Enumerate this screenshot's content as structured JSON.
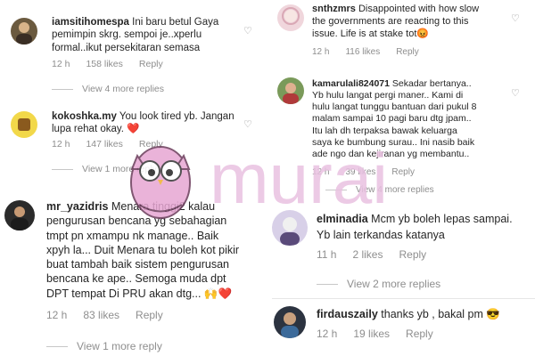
{
  "comments": [
    {
      "username": "iamsitihomespa",
      "text_lines": [
        "Ini baru betul Gaya",
        "pemimpin skrg.  sempoi je..xperlu",
        "formal..ikut persekitaran semasa"
      ],
      "time": "12 h",
      "likes": "158 likes",
      "reply": "Reply",
      "view_more": "View 4 more replies"
    },
    {
      "username": "kokoshka.my",
      "text_lines": [
        "You look tired yb.  Jangan",
        "lupa rehat okay. ❤️"
      ],
      "time": "12 h",
      "likes": "147 likes",
      "reply": "Reply",
      "view_more": "View 1 more reply"
    },
    {
      "username": "mr_yazidris",
      "text_lines": [
        "Menara tinggi2 kalau",
        "pengurusan bencana yg sebahagian",
        "tmpt pn xmampu nk manage.. Baik",
        "xpyh la... Duit Menara tu boleh kot pikir",
        "buat tambah baik sistem pengurusan",
        "bencana ke ape.. Semoga muda dpt",
        "DPT tempat Di PRU akan dtg... 🙌❤️"
      ],
      "time": "12 h",
      "likes": "83 likes",
      "reply": "Reply",
      "view_more": "View 1 more reply"
    },
    {
      "username": "snthzmrs",
      "text_lines": [
        "Disappointed with how slow",
        "the governments are reacting to this",
        "issue. Life is at stake tot😡"
      ],
      "time": "12 h",
      "likes": "116 likes",
      "reply": "Reply"
    },
    {
      "username": "kamarulali824071",
      "text_lines": [
        "Sekadar bertanya..",
        "Yb hulu langat pergi maner.. Kami di",
        "hulu langat tunggu bantuan dari pukul 8",
        "malam sampai 10 pagi baru dtg jpam..",
        "Itu lah dh terpaksa bawak keluarga",
        "saya ke bumbung surau.. Ini nasib baik",
        "ade ngo dan kejiranan yg membantu.."
      ],
      "time": "12 h",
      "likes": "39 likes",
      "reply": "Reply",
      "view_more": "View 4 more replies"
    },
    {
      "username": "elminadia",
      "text_lines": [
        "Mcm yb boleh lepas sampai.",
        "Yb lain terkandas katanya"
      ],
      "time": "11 h",
      "likes": "2 likes",
      "reply": "Reply",
      "view_more": "View 2 more replies"
    },
    {
      "username": "firdauszaily",
      "text_lines": [
        "thanks yb , bakal pm 😎"
      ],
      "time": "12 h",
      "likes": "19 likes",
      "reply": "Reply"
    }
  ],
  "watermark": {
    "brand": "murai"
  },
  "colors": {
    "text": "#262626",
    "meta": "#8e8e8e",
    "watermark": "#e9c1e0",
    "heart_red": "#e0245e"
  }
}
